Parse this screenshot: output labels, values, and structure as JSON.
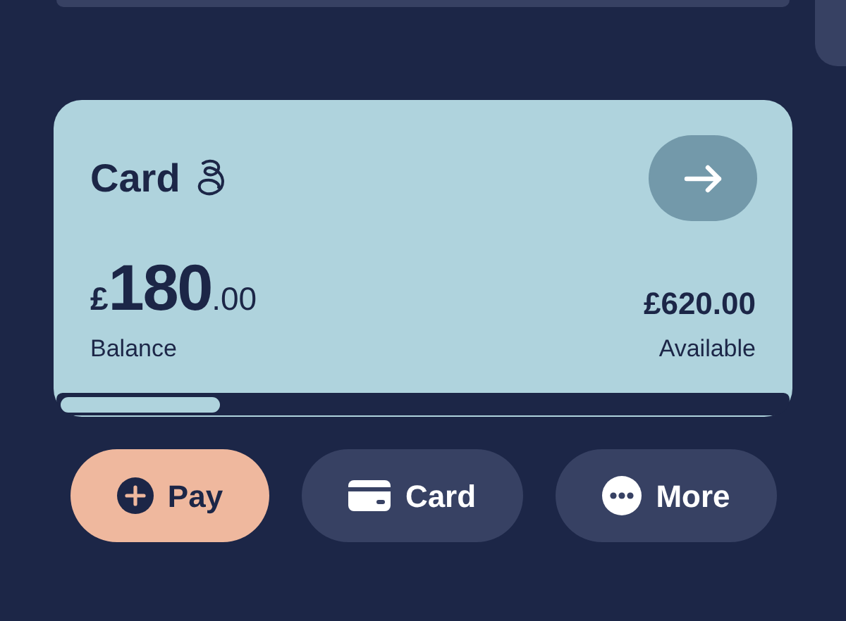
{
  "card": {
    "title": "Card",
    "balance": {
      "currency": "£",
      "whole": "180",
      "fraction": ".00",
      "label": "Balance"
    },
    "available": {
      "amount": "£620.00",
      "label": "Available"
    },
    "level": 0.22
  },
  "actions": [
    {
      "label": "Pay",
      "kind": "primary"
    },
    {
      "label": "Card",
      "kind": "secondary"
    },
    {
      "label": "More",
      "kind": "secondary"
    }
  ]
}
